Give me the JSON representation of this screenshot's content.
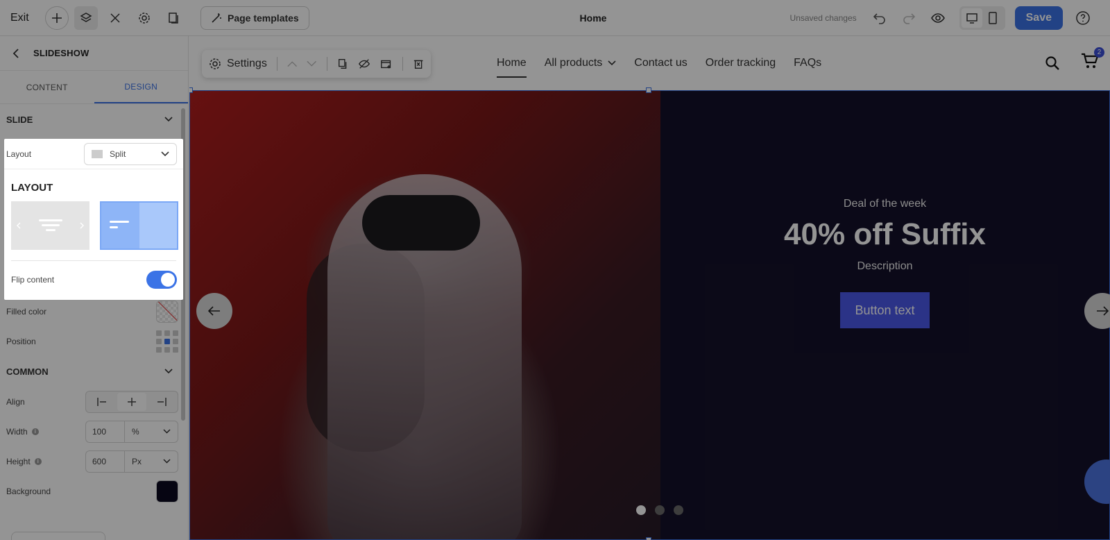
{
  "topbar": {
    "exit_label": "Exit",
    "page_templates_label": "Page templates",
    "page_name": "Home",
    "unsaved_label": "Unsaved changes",
    "save_label": "Save"
  },
  "panel": {
    "title": "SLIDESHOW",
    "tabs": [
      {
        "label": "CONTENT"
      },
      {
        "label": "DESIGN"
      }
    ],
    "slide_section": "SLIDE",
    "layout_label": "Layout",
    "layout_value": "Split",
    "filled_color_label": "Filled color",
    "position_label": "Position",
    "common_section": "COMMON",
    "align_label": "Align",
    "width_label": "Width",
    "width_value": "100",
    "width_unit": "%",
    "height_label": "Height",
    "height_value": "600",
    "height_unit": "Px",
    "background_label": "Background",
    "background_color": "#0b0920"
  },
  "popup": {
    "title": "LAYOUT",
    "flip_label": "Flip content",
    "flip_on": true
  },
  "store": {
    "nav": [
      {
        "label": "Home"
      },
      {
        "label": "All products"
      },
      {
        "label": "Contact us"
      },
      {
        "label": "Order tracking"
      },
      {
        "label": "FAQs"
      }
    ],
    "cart_count": "2",
    "settings_label": "Settings"
  },
  "slide": {
    "eyebrow": "Deal of the week",
    "headline": "40% off Suffix",
    "description": "Description",
    "button_label": "Button text",
    "active_dot": 1,
    "dot_count": 3
  },
  "colors": {
    "accent": "#3b73e6",
    "cta": "#4a59e8",
    "slide_bg": "#14112a"
  }
}
